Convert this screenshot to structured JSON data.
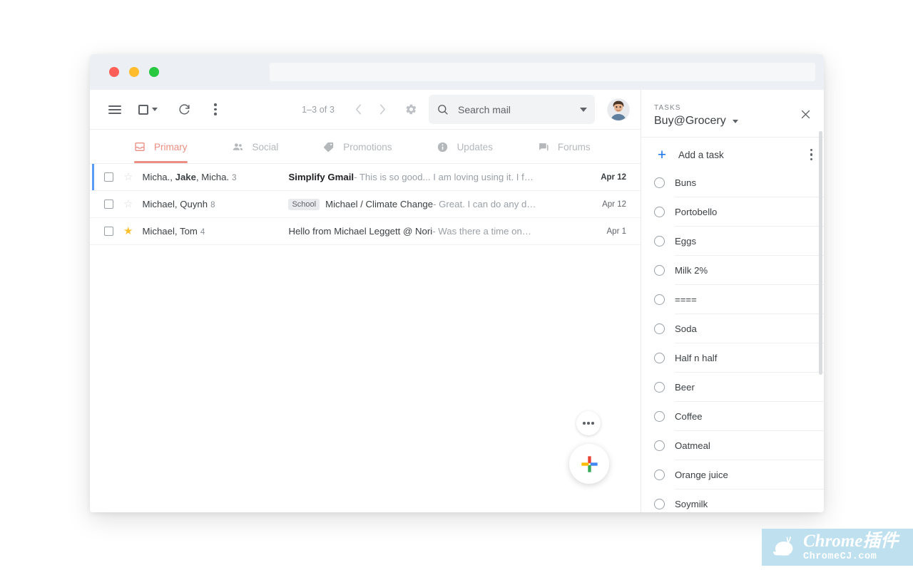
{
  "window": {
    "traffic_lights": [
      {
        "name": "close",
        "color": "#FF5F57"
      },
      {
        "name": "minimize",
        "color": "#FFBD2E"
      },
      {
        "name": "maximize",
        "color": "#28C840"
      }
    ]
  },
  "toolbar": {
    "menu_icon": "hamburger-menu-icon",
    "select_all_icon": "select-checkbox-icon",
    "refresh_icon": "refresh-icon",
    "more_icon": "more-vertical-icon",
    "pager_count": "1–3 of 3",
    "prev_label": "‹",
    "next_label": "›",
    "settings_icon": "gear-icon"
  },
  "search": {
    "icon": "search-icon",
    "placeholder": "Search mail",
    "value": "Search mail",
    "dropdown_icon": "chevron-down-icon"
  },
  "account": {
    "avatar": "user-avatar-photo"
  },
  "tabs": [
    {
      "label": "Primary",
      "icon": "inbox-icon",
      "active": true
    },
    {
      "label": "Social",
      "icon": "people-icon",
      "active": false
    },
    {
      "label": "Promotions",
      "icon": "tag-icon",
      "active": false
    },
    {
      "label": "Updates",
      "icon": "info-icon",
      "active": false
    },
    {
      "label": "Forums",
      "icon": "forum-icon",
      "active": false
    }
  ],
  "emails": [
    {
      "senders": "Micha., Jake, Micha.",
      "senders_bold_part": "Jake",
      "count": "3",
      "label": "",
      "subject": "Simplify Gmail",
      "snippet": " - This is so good... I am loving using it. I f…",
      "date": "Apr 12",
      "starred": false,
      "unread": true,
      "selected": true
    },
    {
      "senders": "Michael, Quynh",
      "count": "8",
      "label": "School",
      "subject": "Michael / Climate Change",
      "snippet": " - Great. I can do any d…",
      "date": "Apr 12",
      "starred": false,
      "unread": false,
      "selected": false
    },
    {
      "senders": "Michael, Tom",
      "count": "4",
      "label": "",
      "subject": "Hello from Michael Leggett @ Nori",
      "snippet": " - Was there a time on…",
      "date": "Apr 1",
      "starred": true,
      "unread": false,
      "selected": false
    }
  ],
  "fab": {
    "more_icon": "more-horizontal-icon",
    "compose_icon": "google-plus-icon"
  },
  "tasks": {
    "kicker": "TASKS",
    "list_name": "Buy@Grocery",
    "dropdown_icon": "chevron-down-icon",
    "close_icon": "close-icon",
    "add_label": "Add a task",
    "add_icon": "plus-icon",
    "menu_icon": "more-vertical-icon",
    "items": [
      {
        "label": "Buns"
      },
      {
        "label": "Portobello"
      },
      {
        "label": "Eggs"
      },
      {
        "label": "Milk 2%"
      },
      {
        "label": "===="
      },
      {
        "label": "Soda"
      },
      {
        "label": "Half n half"
      },
      {
        "label": "Beer"
      },
      {
        "label": "Coffee"
      },
      {
        "label": "Oatmeal"
      },
      {
        "label": "Orange juice"
      },
      {
        "label": "Soymilk"
      }
    ]
  },
  "watermark": {
    "line1": "Chrome插件",
    "line2": "ChromeCJ.com",
    "icon": "snail-logo",
    "bg": "#bfe0ee"
  },
  "colors": {
    "accent_primary": "#ec8e83",
    "selection_bar": "#5b9bf8",
    "add_task_blue": "#1a73e8",
    "star_on": "#fbc02d"
  }
}
